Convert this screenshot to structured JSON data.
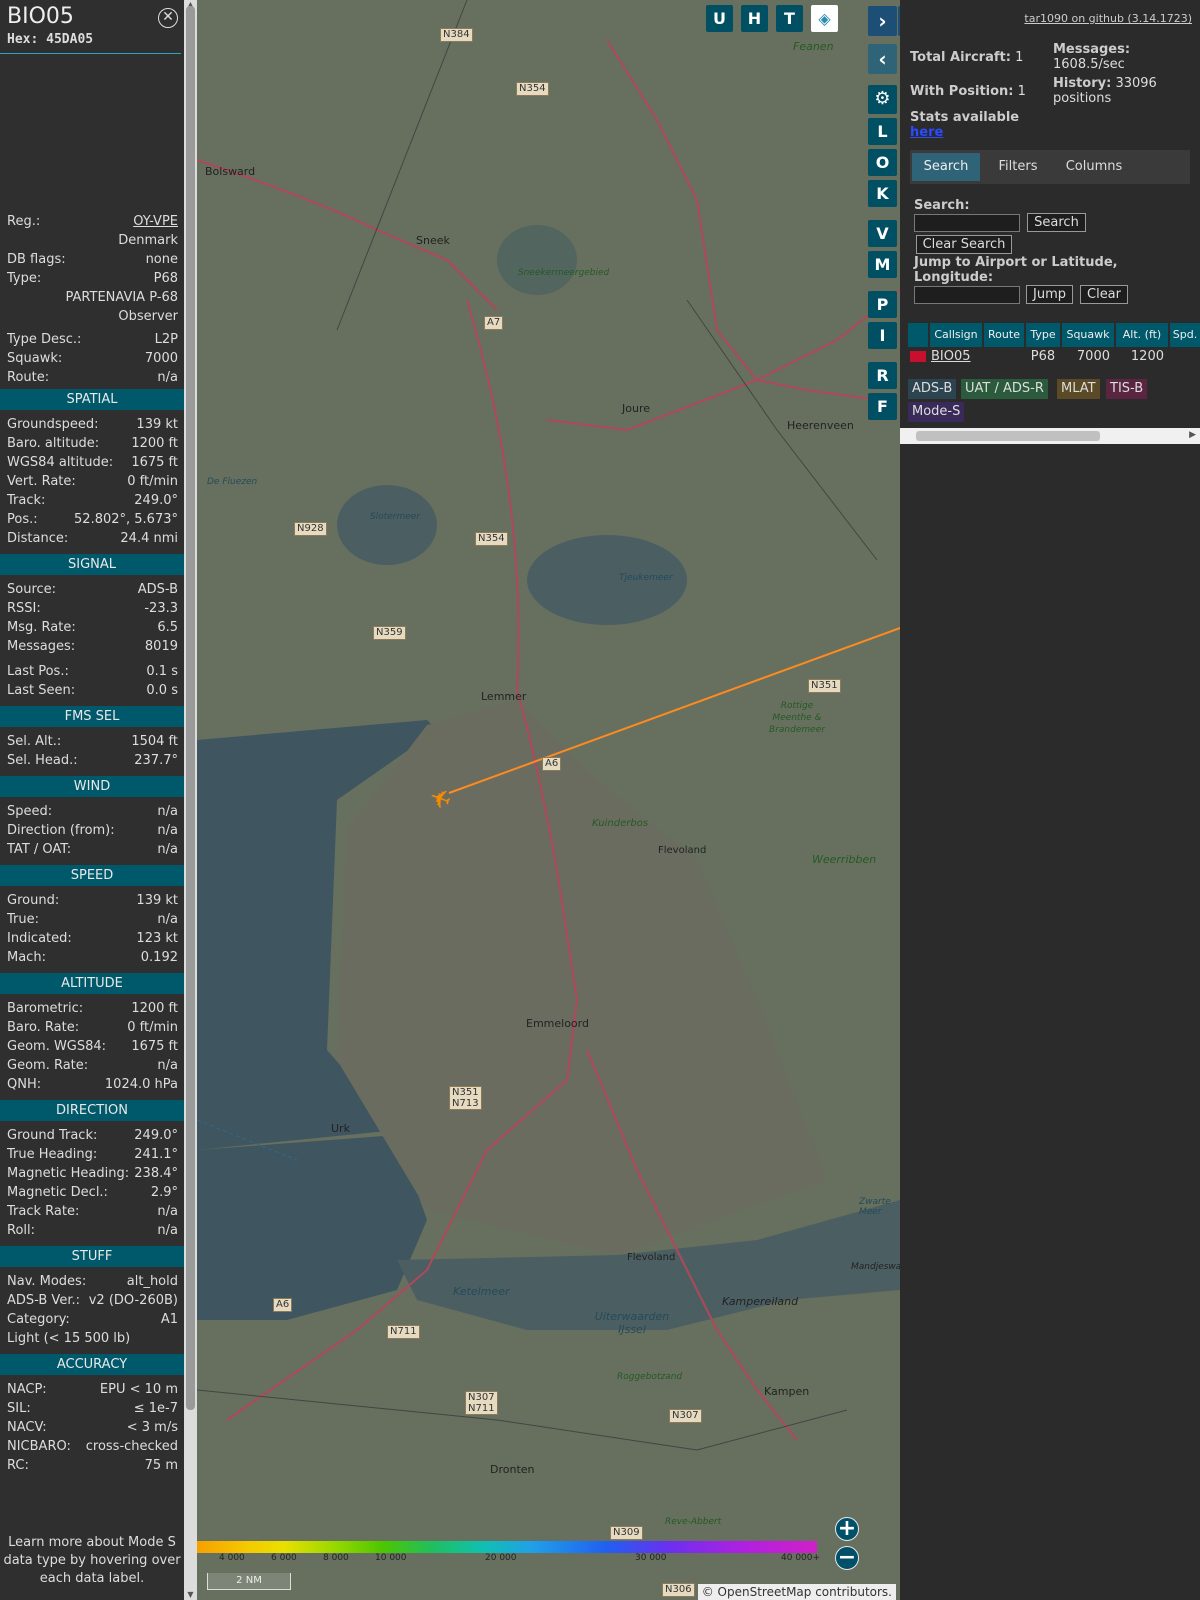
{
  "sidebar": {
    "title": "BIO05",
    "hex_label": "Hex:",
    "hex": "45DA05",
    "rows": [
      {
        "label": "Reg.:",
        "value": "OY-VPE",
        "link": true
      },
      {
        "label": "",
        "value": "Denmark"
      },
      {
        "label": "DB flags:",
        "value": "none"
      },
      {
        "label": "Type:",
        "value": "P68"
      },
      {
        "label": "",
        "value": "PARTENAVIA P-68"
      },
      {
        "label": "",
        "value": "Observer"
      },
      {
        "label": "Type Desc.:",
        "value": "L2P"
      },
      {
        "label": "Squawk:",
        "value": "7000"
      },
      {
        "label": "Route:",
        "value": "n/a"
      }
    ],
    "sections": [
      {
        "title": "SPATIAL",
        "rows": [
          {
            "label": "Groundspeed:",
            "value": "139 kt"
          },
          {
            "label": "Baro. altitude:",
            "value": "1200 ft"
          },
          {
            "label": "WGS84 altitude:",
            "value": "1675 ft"
          },
          {
            "label": "Vert. Rate:",
            "value": "0 ft/min"
          },
          {
            "label": "Track:",
            "value": "249.0°"
          },
          {
            "label": "Pos.:",
            "value": "52.802°, 5.673°"
          },
          {
            "label": "Distance:",
            "value": "24.4 nmi"
          }
        ]
      },
      {
        "title": "SIGNAL",
        "rows": [
          {
            "label": "Source:",
            "value": "ADS-B"
          },
          {
            "label": "RSSI:",
            "value": "-23.3"
          },
          {
            "label": "Msg. Rate:",
            "value": "6.5"
          },
          {
            "label": "Messages:",
            "value": "8019"
          },
          {
            "label": "Last Pos.:",
            "value": "0.1 s"
          },
          {
            "label": "Last Seen:",
            "value": "0.0 s"
          }
        ]
      },
      {
        "title": "FMS SEL",
        "rows": [
          {
            "label": "Sel. Alt.:",
            "value": "1504 ft"
          },
          {
            "label": "Sel. Head.:",
            "value": "237.7°"
          }
        ]
      },
      {
        "title": "WIND",
        "rows": [
          {
            "label": "Speed:",
            "value": "n/a"
          },
          {
            "label": "Direction (from):",
            "value": "n/a"
          },
          {
            "label": "TAT / OAT:",
            "value": "n/a"
          }
        ]
      },
      {
        "title": "SPEED",
        "rows": [
          {
            "label": "Ground:",
            "value": "139 kt"
          },
          {
            "label": "True:",
            "value": "n/a"
          },
          {
            "label": "Indicated:",
            "value": "123 kt"
          },
          {
            "label": "Mach:",
            "value": "0.192"
          }
        ]
      },
      {
        "title": "ALTITUDE",
        "rows": [
          {
            "label": "Barometric:",
            "value": "1200 ft"
          },
          {
            "label": "Baro. Rate:",
            "value": "0 ft/min"
          },
          {
            "label": "Geom. WGS84:",
            "value": "1675 ft"
          },
          {
            "label": "Geom. Rate:",
            "value": "n/a"
          },
          {
            "label": "QNH:",
            "value": "1024.0 hPa"
          }
        ]
      },
      {
        "title": "DIRECTION",
        "rows": [
          {
            "label": "Ground Track:",
            "value": "249.0°"
          },
          {
            "label": "True Heading:",
            "value": "241.1°"
          },
          {
            "label": "Magnetic Heading:",
            "value": "238.4°"
          },
          {
            "label": "Magnetic Decl.:",
            "value": "2.9°"
          },
          {
            "label": "Track Rate:",
            "value": "n/a"
          },
          {
            "label": "Roll:",
            "value": "n/a"
          }
        ]
      },
      {
        "title": "STUFF",
        "rows": [
          {
            "label": "Nav. Modes:",
            "value": "alt_hold"
          },
          {
            "label": "ADS-B Ver.:",
            "value": "v2 (DO-260B)"
          },
          {
            "label": "Category:",
            "value": "A1"
          },
          {
            "label": "Light (< 15 500 lb)",
            "value": ""
          }
        ]
      },
      {
        "title": "ACCURACY",
        "rows": [
          {
            "label": "NACP:",
            "value": "EPU < 10 m"
          },
          {
            "label": "SIL:",
            "value": "≤ 1e-7"
          },
          {
            "label": "NACV:",
            "value": "< 3 m/s"
          },
          {
            "label": "NICBARO:",
            "value": "cross-checked"
          },
          {
            "label": "RC:",
            "value": "75 m"
          }
        ]
      }
    ],
    "footer": "Learn more about Mode S data type by hovering over each data label."
  },
  "map": {
    "top_buttons": [
      "U",
      "H",
      "T"
    ],
    "side_buttons": [
      "L",
      "O",
      "K",
      "V",
      "M",
      "P",
      "I",
      "R",
      "F"
    ],
    "places": [
      "Bolsward",
      "Sneek",
      "Joure",
      "Heerenveen",
      "Lemmer",
      "Emmeloord",
      "Urk",
      "Dronten",
      "Kampen",
      "Kampereiland",
      "Flevoland",
      "Flevoland",
      "Weerribben",
      "Kuinderbos",
      "Ketelmeer",
      "Uiterwaarden IJssel",
      "Roggebotzand",
      "Reve-Abbert",
      "Tjeukemeer",
      "Sneekermeergebied",
      "Slotermeer",
      "De Fluezen",
      "Rottige Meenthe & Brandemeer",
      "Zwarte Meer",
      "Mandjeswa",
      "Feanen"
    ],
    "roads": [
      "N384",
      "N354",
      "A7",
      "N928",
      "N354",
      "N359",
      "A6",
      "N351",
      "N351",
      "N713",
      "A6",
      "N711",
      "N307",
      "N711",
      "N307",
      "N309",
      "N306"
    ],
    "colorbar_ticks": [
      "4 000",
      "6 000",
      "8 000",
      "10 000",
      "20 000",
      "30 000",
      "40 000+"
    ],
    "scale": "2 NM",
    "attribution": "© OpenStreetMap contributors."
  },
  "panel": {
    "github": "tar1090 on github (3.14.1723)",
    "total_label": "Total Aircraft:",
    "total": "1",
    "withpos_label": "With Position:",
    "withpos": "1",
    "messages_label": "Messages:",
    "messages": "1608.5/sec",
    "history_label": "History:",
    "history": "33096 positions",
    "stats_label": "Stats available",
    "stats_link": "here",
    "tabs": [
      "Search",
      "Filters",
      "Columns"
    ],
    "search_label": "Search:",
    "search_btn": "Search",
    "clear_search_btn": "Clear Search",
    "jump_label": "Jump to Airport or Latitude, Longitude:",
    "jump_btn": "Jump",
    "clear_btn": "Clear",
    "columns": [
      "Callsign",
      "Route",
      "Type",
      "Squawk",
      "Alt. (ft)",
      "Spd."
    ],
    "row": {
      "callsign": "BIO05",
      "route": "",
      "type": "P68",
      "squawk": "7000",
      "alt": "1200"
    },
    "badges": [
      "ADS-B",
      "UAT / ADS-R",
      "MLAT",
      "TIS-B",
      "Mode-S"
    ]
  }
}
